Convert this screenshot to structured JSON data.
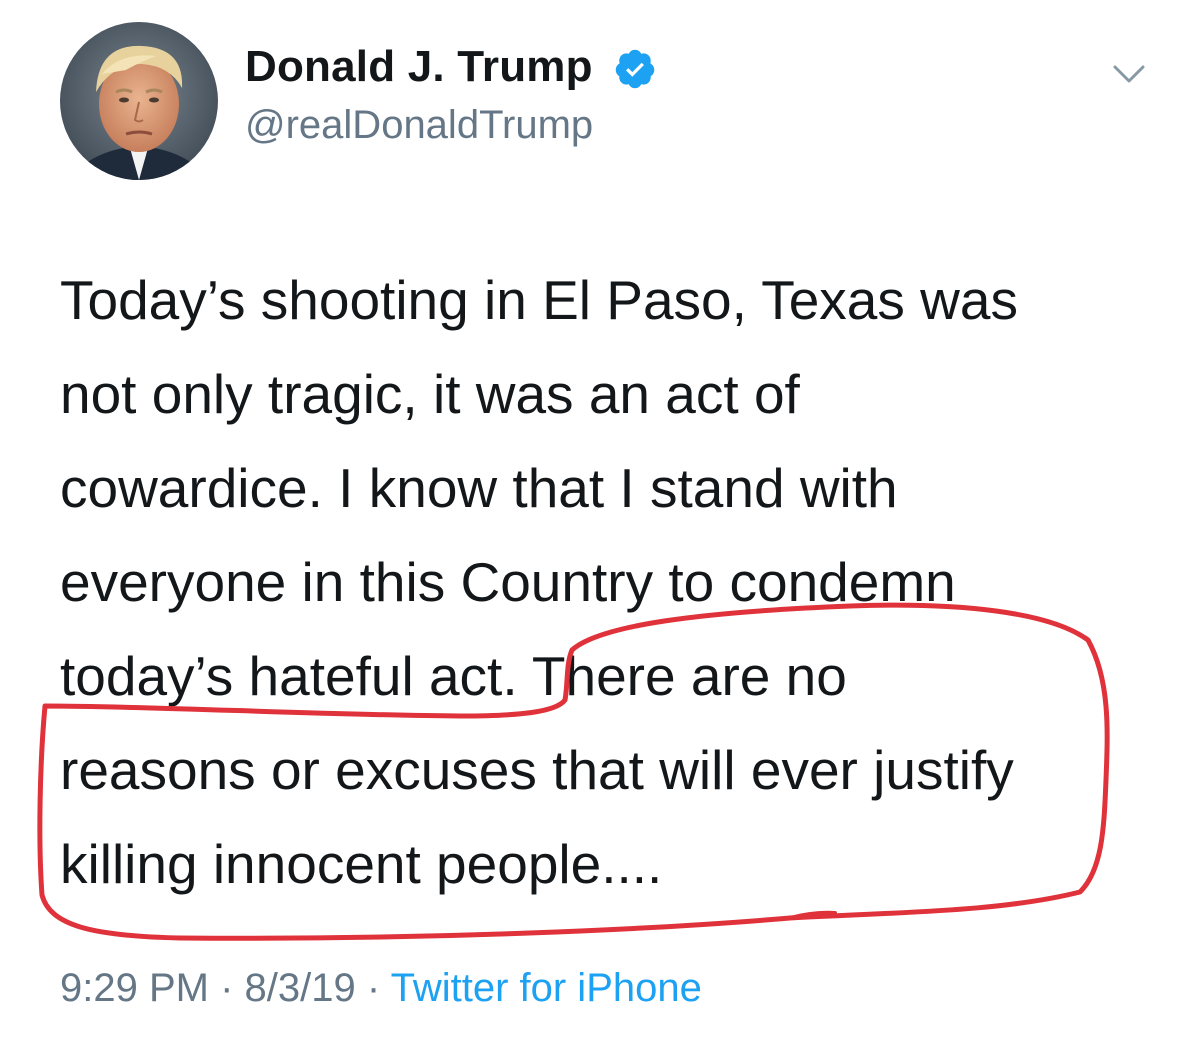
{
  "author": {
    "display_name": "Donald J. Trump",
    "handle": "@realDonaldTrump",
    "verified": true,
    "avatar_icon": "profile-photo",
    "verified_icon": "verified-badge-icon",
    "menu_icon": "chevron-down-icon"
  },
  "tweet": {
    "lines": [
      "Today’s shooting in El Paso, Texas was",
      "not only tragic, it was an act of",
      "cowardice. I know that I stand with",
      "everyone in this Country to condemn",
      "today’s hateful act. There are no",
      "reasons or excuses that will ever justify",
      "killing innocent people...."
    ]
  },
  "meta": {
    "time": "9:29 PM",
    "separator": "·",
    "date": "8/3/19",
    "source": "Twitter for iPhone"
  },
  "colors": {
    "text": "#14171a",
    "secondary": "#657786",
    "link": "#1da1f2",
    "verified": "#1da1f2",
    "annotation": "#e0323a"
  }
}
